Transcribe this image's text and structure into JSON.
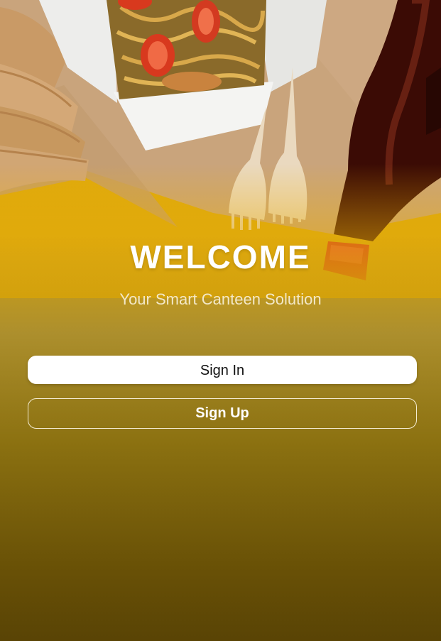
{
  "welcome": {
    "title": "WELCOME",
    "tagline": "Your Smart Canteen Solution"
  },
  "actions": {
    "sign_in_label": "Sign In",
    "sign_up_label": "Sign Up"
  },
  "colors": {
    "accent": "#f2b205",
    "background_bottom": "#6a5106",
    "button_primary_bg": "#ffffff",
    "button_outline": "#f4ecd2"
  },
  "hero_image": {
    "subject": "noodle takeout box, paper cups, wooden forks and cola bottle on kraft paper"
  }
}
